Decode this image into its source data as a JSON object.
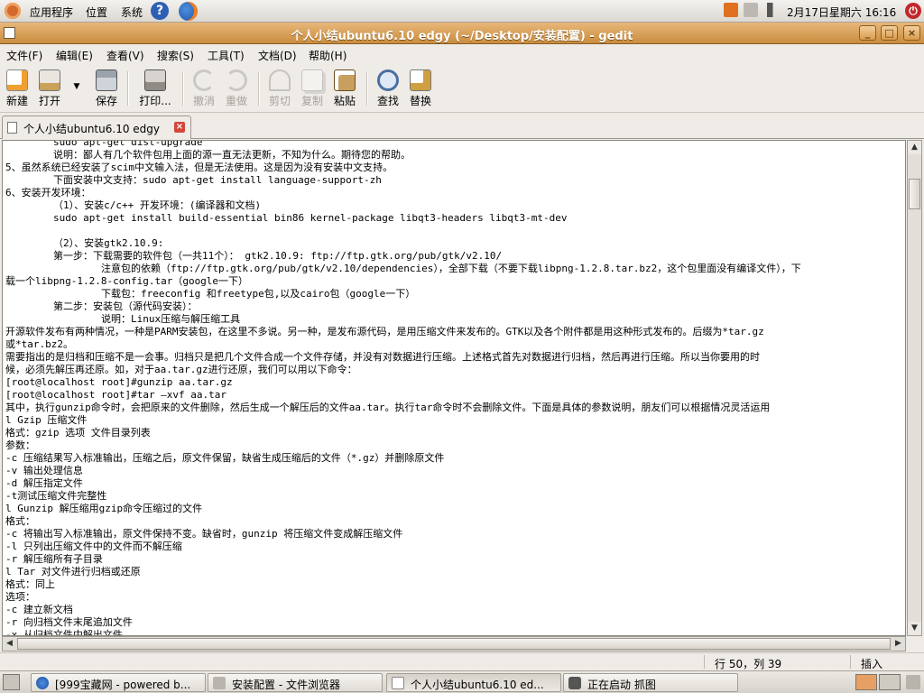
{
  "top_panel": {
    "menus": [
      "应用程序",
      "位置",
      "系统"
    ],
    "clock": "2月17日星期六 16:16"
  },
  "window": {
    "title": "个人小结ubuntu6.10 edgy (~/Desktop/安装配置) - gedit",
    "buttons": {
      "minimize": "_",
      "maximize": "□",
      "close": "×"
    }
  },
  "menubar": [
    "文件(F)",
    "编辑(E)",
    "查看(V)",
    "搜索(S)",
    "工具(T)",
    "文档(D)",
    "帮助(H)"
  ],
  "toolbar": {
    "new": "新建",
    "open": "打开",
    "save": "保存",
    "print": "打印...",
    "undo": "撤消",
    "redo": "重做",
    "cut": "剪切",
    "copy": "复制",
    "paste": "粘贴",
    "find": "查找",
    "replace": "替换"
  },
  "tab": {
    "label": "个人小结ubuntu6.10 edgy"
  },
  "editor": {
    "lines": [
      "        sudo apt-get dist-upgrade",
      "        说明：鄙人有几个软件包用上面的源一直无法更新，不知为什么。期待您的帮助。",
      "5、虽然系统已经安装了scim中文输入法，但是无法使用。这是因为没有安装中文支持。",
      "        下面安装中文支持：sudo apt-get install language-support-zh",
      "6、安装开发环境：",
      "        （1）、安装c/c++ 开发环境：(编译器和文档)",
      "        sudo apt-get install build-essential bin86 kernel-package libqt3-headers libqt3-mt-dev",
      "",
      "        （2）、安装gtk2.10.9:",
      "        第一步：下载需要的软件包（一共11个）： gtk2.10.9: ftp://ftp.gtk.org/pub/gtk/v2.10/",
      "                注意包的依赖（ftp://ftp.gtk.org/pub/gtk/v2.10/dependencies），全部下载（不要下载libpng-1.2.8.tar.bz2，这个包里面没有编译文件），下",
      "载一个libpng-1.2.8-config.tar（google一下）",
      "                下载包：freeconfig 和freetype包,以及cairo包（google一下）",
      "        第二步：安装包（源代码安装）：",
      "                说明：Linux压缩与解压缩工具",
      "开源软件发布有两种情况，一种是PARM安装包，在这里不多说。另一种，是发布源代码，是用压缩文件来发布的。GTK以及各个附件都是用这种形式发布的。后缀为*tar.gz",
      "或*tar.bz2。",
      "需要指出的是归档和压缩不是一会事。归档只是把几个文件合成一个文件存储，并没有对数据进行压缩。上述格式首先对数据进行归档，然后再进行压缩。所以当你要用的时",
      "候，必须先解压再还原。如，对于aa.tar.gz进行还原，我们可以用以下命令：",
      "[root@localhost root]#gunzip aa.tar.gz",
      "[root@localhost root]#tar –xvf aa.tar",
      "其中，执行gunzip命令时，会把原来的文件删除，然后生成一个解压后的文件aa.tar。执行tar命令时不会删除文件。下面是具体的参数说明，朋友们可以根据情况灵活运用",
      "l Gzip 压缩文件",
      "格式：gzip 选项 文件目录列表",
      "参数：",
      "-c 压缩结果写入标准输出，压缩之后，原文件保留，缺省生成压缩后的文件（*.gz）并删除原文件",
      "-v 输出处理信息",
      "-d 解压指定文件",
      "-t测试压缩文件完整性",
      "l Gunzip 解压缩用gzip命令压缩过的文件",
      "格式：",
      "-c 将输出写入标准输出，原文件保持不变。缺省时，gunzip 将压缩文件变成解压缩文件",
      "-l 只列出压缩文件中的文件而不解压缩",
      "-r 解压缩所有子目录",
      "l Tar 对文件进行归档或还原",
      "格式：同上",
      "选项：",
      "-c 建立新文档",
      "-r 向归档文件末尾追加文件",
      "-x 从归档文件中解出文件"
    ]
  },
  "statusbar": {
    "position": "行 50，列 39",
    "mode": "插入"
  },
  "taskbar": [
    {
      "label": "[999宝藏网 - powered b..."
    },
    {
      "label": "安装配置 - 文件浏览器"
    },
    {
      "label": "个人小结ubuntu6.10 ed..."
    },
    {
      "label": "正在启动 抓图"
    }
  ],
  "icons": {
    "new": "new-document-icon",
    "open": "open-folder-icon",
    "save": "floppy-icon",
    "print": "printer-icon",
    "find": "magnifier-icon",
    "replace": "replace-icon"
  }
}
